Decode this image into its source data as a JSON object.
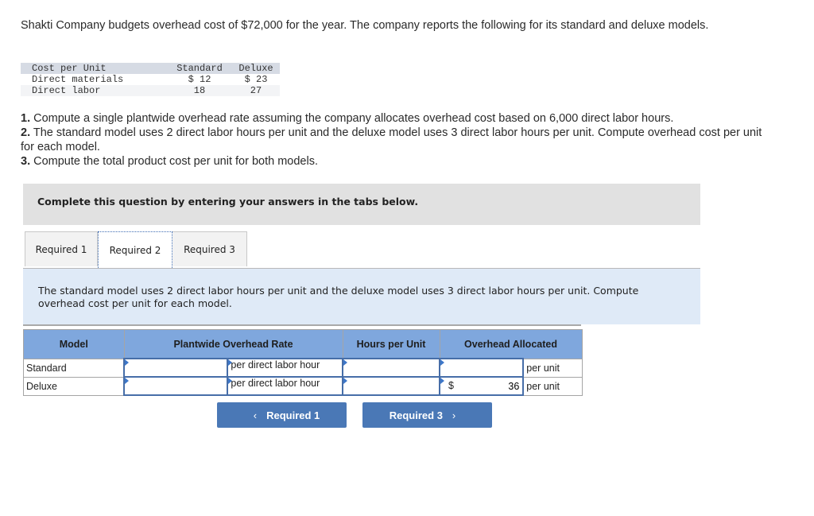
{
  "intro": "Shakti Company budgets overhead cost of $72,000 for the year. The company reports the following for its standard and deluxe models.",
  "cost_table": {
    "headers": [
      "Cost per Unit",
      "Standard",
      "Deluxe"
    ],
    "rows": [
      [
        "Direct materials",
        "$ 12",
        "$ 23"
      ],
      [
        "Direct labor",
        "18",
        "27"
      ]
    ]
  },
  "requirements": [
    {
      "num": "1.",
      "text": " Compute a single plantwide overhead rate assuming the company allocates overhead cost based on 6,000 direct labor hours."
    },
    {
      "num": "2.",
      "text": " The standard model uses 2 direct labor hours per unit and the deluxe model uses 3 direct labor hours per unit. Compute overhead cost per unit for each model."
    },
    {
      "num": "3.",
      "text": " Compute the total product cost per unit for both models."
    }
  ],
  "instruction": "Complete this question by entering your answers in the tabs below.",
  "tabs": [
    {
      "label": "Required 1",
      "active": false
    },
    {
      "label": "Required 2",
      "active": true
    },
    {
      "label": "Required 3",
      "active": false
    }
  ],
  "prompt": "The standard model uses 2 direct labor hours per unit and the deluxe model uses 3 direct labor hours per unit. Compute overhead cost per unit for each model.",
  "answer_table": {
    "headers": [
      "Model",
      "Plantwide Overhead Rate",
      "Hours per Unit",
      "Overhead Allocated"
    ],
    "rate_unit": "per direct labor hour",
    "alloc_unit": "per unit",
    "currency": "$",
    "rows": [
      {
        "model": "Standard",
        "rate": "",
        "hours": "",
        "allocated": "",
        "show_currency": false
      },
      {
        "model": "Deluxe",
        "rate": "",
        "hours": "",
        "allocated": "36",
        "show_currency": true
      }
    ]
  },
  "nav": {
    "prev_label": "Required 1",
    "next_label": "Required 3",
    "prev_icon": "‹",
    "next_icon": "›"
  }
}
